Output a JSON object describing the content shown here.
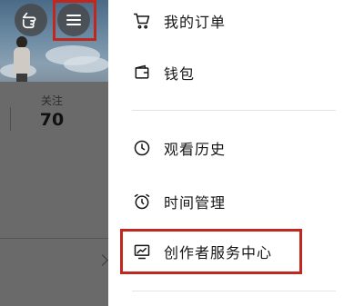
{
  "profile": {
    "stat_label": "关注",
    "stat_value": "70"
  },
  "top_buttons": {
    "hand_icon": "hand-pointer-icon",
    "menu_icon": "hamburger-menu-icon"
  },
  "drawer": {
    "items": [
      {
        "label": "我的订单",
        "icon": "cart-icon"
      },
      {
        "label": "钱包",
        "icon": "wallet-icon"
      },
      {
        "label": "观看历史",
        "icon": "clock-icon"
      },
      {
        "label": "时间管理",
        "icon": "alarm-clock-icon"
      },
      {
        "label": "创作者服务中心",
        "icon": "creator-chart-icon"
      }
    ]
  },
  "colors": {
    "highlight": "#c0281f",
    "text": "#161616",
    "overlay": "#5e5e5e"
  }
}
